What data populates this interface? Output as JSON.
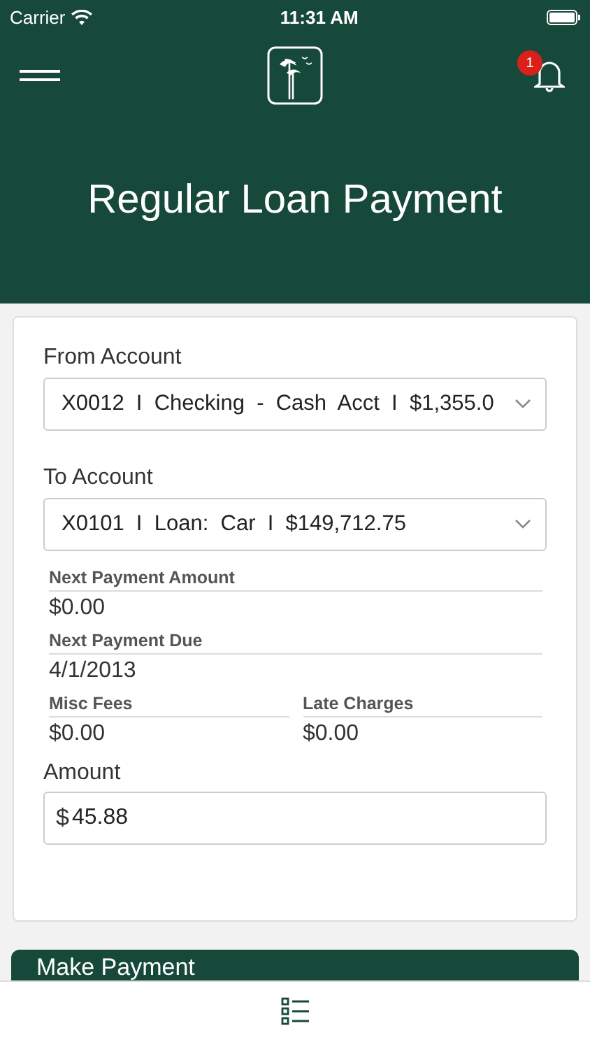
{
  "status_bar": {
    "carrier": "Carrier",
    "time": "11:31 AM"
  },
  "header": {
    "title": "Regular Loan Payment",
    "notification_count": "1"
  },
  "form": {
    "from_account": {
      "label": "From Account",
      "value": "X0012  I  Checking  -  Cash  Acct  I  $1,355.0"
    },
    "to_account": {
      "label": "To Account",
      "value": "X0101  I  Loan:  Car  I  $149,712.75"
    },
    "details": [
      {
        "label": "Next Payment Amount",
        "value": "$0.00",
        "kind": "full"
      },
      {
        "label": "Next Payment Due",
        "value": "4/1/2013",
        "kind": "full"
      },
      {
        "label": "Misc Fees",
        "value": "$0.00",
        "kind": "half"
      },
      {
        "label": "Late Charges",
        "value": "$0.00",
        "kind": "half"
      }
    ],
    "amount": {
      "label": "Amount",
      "currency": "$",
      "value": "45.88"
    }
  },
  "submit_button": "Make Payment"
}
